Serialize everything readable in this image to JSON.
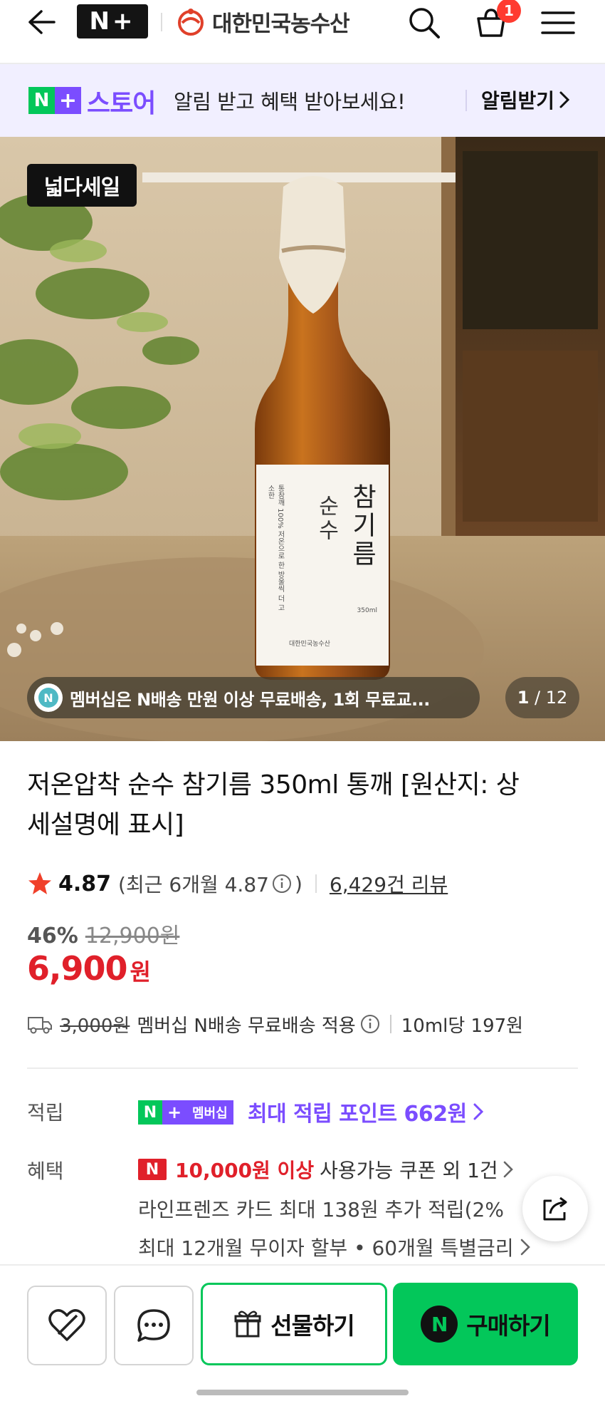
{
  "header": {
    "logo": "N+",
    "brand": "대한민국농수산",
    "cart_count": "1"
  },
  "banner": {
    "store": "스토어",
    "message": "알림 받고 혜택 받아보세요!",
    "link": "알림받기"
  },
  "hero": {
    "sale_badge": "넓다세일",
    "membership_text": "멤버십은 N배송 만원 이상 무료배송, 1회 무료교...",
    "page_current": "1",
    "page_total": "/ 12",
    "label_title": "참기름",
    "label_sub": "순수",
    "label_vertical": "통참깨 100% 저온으로 한 방울씩 더 고소한",
    "label_volume": "350ml",
    "label_brand": "대한민국농수산"
  },
  "product": {
    "title": "저온압착 순수 참기름 350ml 통깨 [원산지: 상세설명에 표시]",
    "rating": "4.87",
    "rating_recent": "(최근 6개월 4.87",
    "rating_close": ")",
    "reviews": "6,429건 리뷰",
    "discount_pct": "46%",
    "original_price": "12,900원",
    "price": "6,900",
    "price_unit": "원",
    "ship_fee": "3,000원",
    "ship_text": "멤버십 N배송 무료배송 적용",
    "unit_price": "10ml당 197원"
  },
  "points": {
    "label": "적립",
    "badge": "멤버십",
    "text": "최대 적립 포인트 662원"
  },
  "benefits": {
    "label": "혜택",
    "coupon_amount": "10,000원 이상",
    "coupon_text": "사용가능 쿠폰 외 1건",
    "card": "라인프렌즈 카드 최대 138원 추가 적립(2%",
    "installment": "최대 12개월 무이자 할부 • 60개월 특별금리"
  },
  "bottom": {
    "gift": "선물하기",
    "buy": "구매하기"
  },
  "colors": {
    "naver_green": "#03c75a",
    "plus_purple": "#7b4dff",
    "price_red": "#e0202a",
    "banner_bg": "#f1efff"
  },
  "icons": [
    "back-arrow-icon",
    "search-icon",
    "cart-icon",
    "menu-icon",
    "star-icon",
    "info-icon",
    "truck-icon",
    "chevron-right-icon",
    "share-icon",
    "heart-icon",
    "chat-icon",
    "gift-icon"
  ]
}
